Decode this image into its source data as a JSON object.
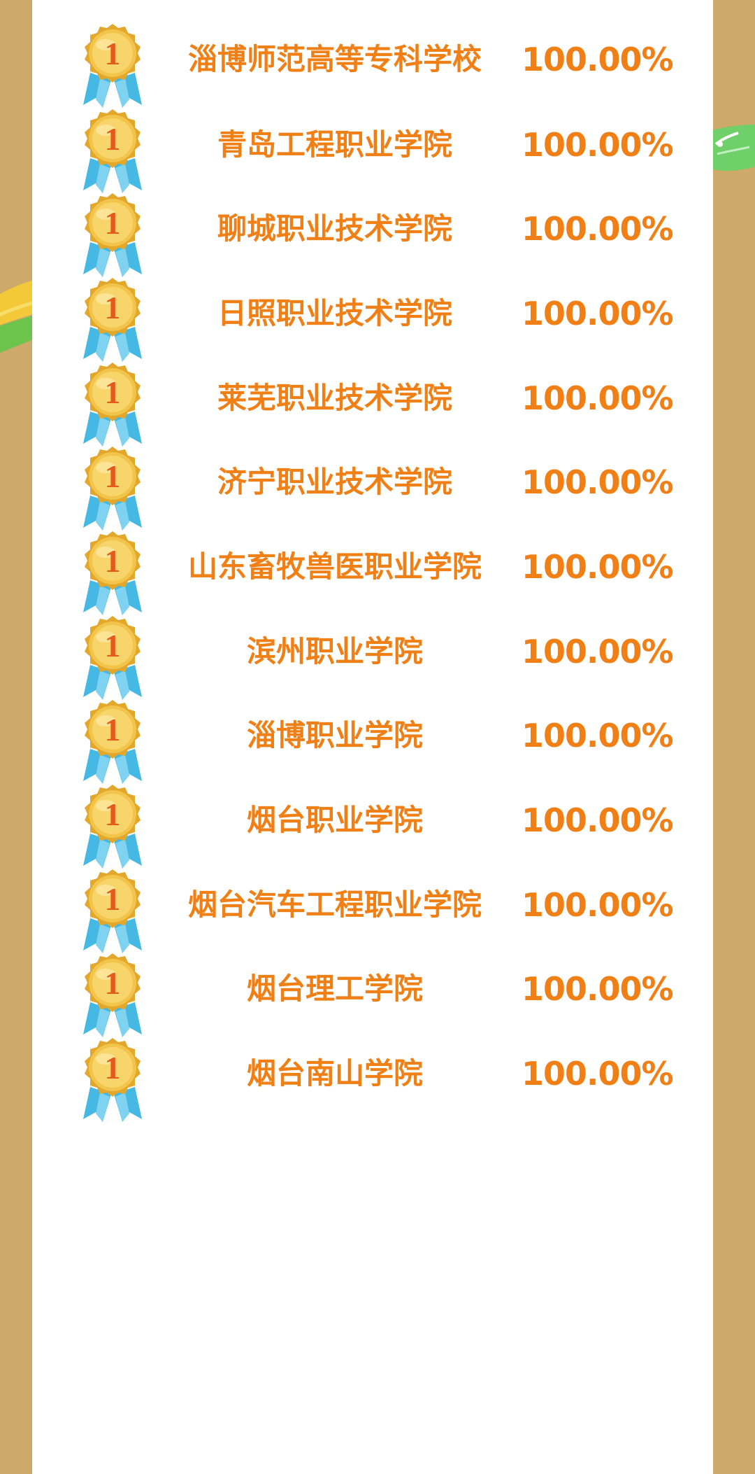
{
  "colors": {
    "background": "#cdaa69",
    "panel": "#ffffff",
    "text_accent": "#f07f16",
    "medal_gold": "#e8b636",
    "medal_ribbon": "#45b8e3"
  },
  "rows": [
    {
      "medal_icon": "gold-medal-1-icon",
      "medal_number": "1",
      "school": "淄博师范高等专科学校",
      "rate": "100.00%"
    },
    {
      "medal_icon": "gold-medal-1-icon",
      "medal_number": "1",
      "school": "青岛工程职业学院",
      "rate": "100.00%"
    },
    {
      "medal_icon": "gold-medal-1-icon",
      "medal_number": "1",
      "school": "聊城职业技术学院",
      "rate": "100.00%"
    },
    {
      "medal_icon": "gold-medal-1-icon",
      "medal_number": "1",
      "school": "日照职业技术学院",
      "rate": "100.00%"
    },
    {
      "medal_icon": "gold-medal-1-icon",
      "medal_number": "1",
      "school": "莱芜职业技术学院",
      "rate": "100.00%"
    },
    {
      "medal_icon": "gold-medal-1-icon",
      "medal_number": "1",
      "school": "济宁职业技术学院",
      "rate": "100.00%"
    },
    {
      "medal_icon": "gold-medal-1-icon",
      "medal_number": "1",
      "school": "山东畜牧兽医职业学院",
      "rate": "100.00%"
    },
    {
      "medal_icon": "gold-medal-1-icon",
      "medal_number": "1",
      "school": "滨州职业学院",
      "rate": "100.00%"
    },
    {
      "medal_icon": "gold-medal-1-icon",
      "medal_number": "1",
      "school": "淄博职业学院",
      "rate": "100.00%"
    },
    {
      "medal_icon": "gold-medal-1-icon",
      "medal_number": "1",
      "school": "烟台职业学院",
      "rate": "100.00%"
    },
    {
      "medal_icon": "gold-medal-1-icon",
      "medal_number": "1",
      "school": "烟台汽车工程职业学院",
      "rate": "100.00%"
    },
    {
      "medal_icon": "gold-medal-1-icon",
      "medal_number": "1",
      "school": "烟台理工学院",
      "rate": "100.00%"
    },
    {
      "medal_icon": "gold-medal-1-icon",
      "medal_number": "1",
      "school": "烟台南山学院",
      "rate": "100.00%"
    }
  ]
}
